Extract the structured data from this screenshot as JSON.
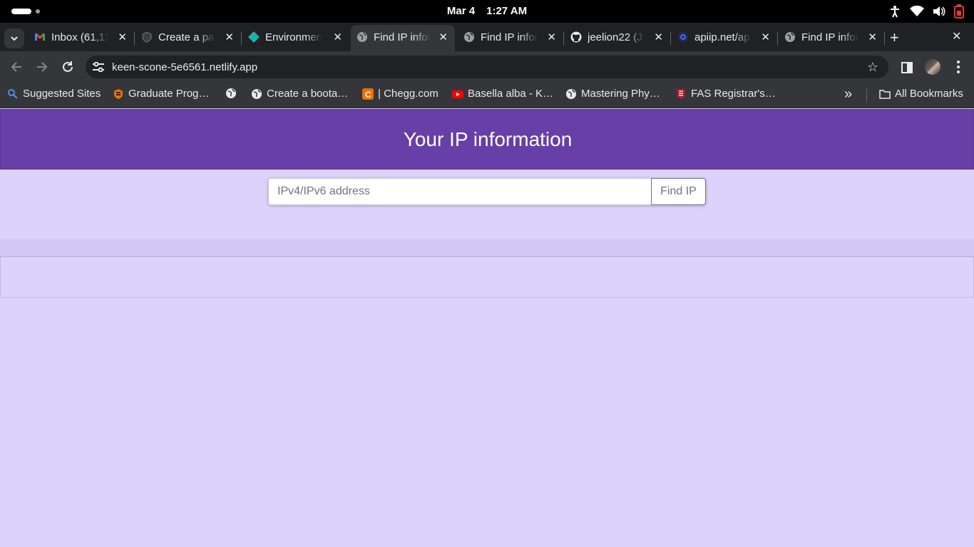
{
  "os_bar": {
    "date": "Mar 4",
    "time": "1:27 AM"
  },
  "browser": {
    "tabs": [
      {
        "title": "Inbox (61,12",
        "favicon": "gmail-icon",
        "active": false
      },
      {
        "title": "Create a pas",
        "favicon": "shield-icon",
        "active": false
      },
      {
        "title": "Environmen",
        "favicon": "diamond-icon",
        "active": false
      },
      {
        "title": "Find IP infor",
        "favicon": "globe-icon",
        "active": true
      },
      {
        "title": "Find IP infor",
        "favicon": "globe-icon",
        "active": false
      },
      {
        "title": "jeelion22 (J",
        "favicon": "github-icon",
        "active": false
      },
      {
        "title": "apiip.net/ap",
        "favicon": "apiip-icon",
        "active": false
      },
      {
        "title": "Find IP infor",
        "favicon": "globe-icon",
        "active": false
      }
    ],
    "url": "keen-scone-5e6561.netlify.app",
    "bookmarks": [
      {
        "label": "Suggested Sites",
        "icon": "search-icon"
      },
      {
        "label": "Graduate Prog…",
        "icon": "princeton-icon"
      },
      {
        "label": "",
        "icon": "globe-icon"
      },
      {
        "label": "Create a boota…",
        "icon": "globe-icon"
      },
      {
        "label": "| Chegg.com",
        "icon": "chegg-icon"
      },
      {
        "label": "Basella alba - K…",
        "icon": "youtube-icon"
      },
      {
        "label": "Mastering Phy…",
        "icon": "globe-icon"
      },
      {
        "label": "FAS Registrar's…",
        "icon": "harvard-icon"
      }
    ],
    "all_bookmarks_label": "All Bookmarks"
  },
  "page": {
    "title": "Your IP information",
    "input_placeholder": "IPv4/IPv6 address",
    "input_value": "",
    "button_label": "Find IP"
  },
  "colors": {
    "header": "#673fa6",
    "background": "#dcd2fc"
  }
}
